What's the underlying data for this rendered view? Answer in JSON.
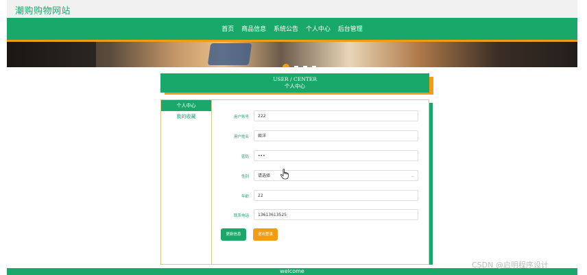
{
  "site": {
    "title": "潮购购物网站"
  },
  "nav": {
    "items": [
      "首页",
      "商品信息",
      "系统公告",
      "个人中心",
      "后台管理"
    ]
  },
  "card": {
    "title_en": "USER / CENTER",
    "title_cn": "个人中心"
  },
  "sidebar": {
    "items": [
      {
        "label": "个人中心",
        "active": true
      },
      {
        "label": "我的收藏",
        "active": false
      }
    ]
  },
  "form": {
    "fields": [
      {
        "label": "用户账号",
        "value": "222"
      },
      {
        "label": "用户姓名",
        "value": "姬洋"
      },
      {
        "label": "密码",
        "value": "•••"
      },
      {
        "label": "性别",
        "value": "请选择"
      },
      {
        "label": "年龄",
        "value": "22"
      },
      {
        "label": "联系电话",
        "value": "13613613525"
      }
    ],
    "update_label": "更新信息",
    "logout_label": "退出登录"
  },
  "footer": {
    "text": "welcome"
  },
  "watermark": "CSDN @启明程序设计",
  "colors": {
    "brand_green": "#1aa86a",
    "accent_orange": "#f39c12"
  }
}
